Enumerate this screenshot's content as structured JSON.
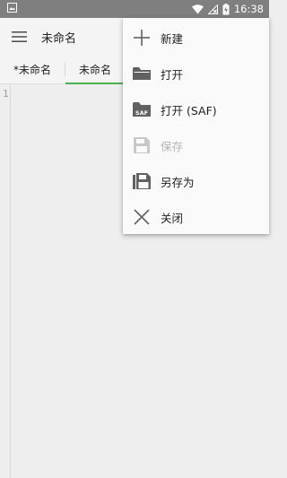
{
  "status_bar": {
    "time": "16:38",
    "icons": [
      "image-icon",
      "wifi-icon",
      "signal-off-icon",
      "battery-charging-icon"
    ]
  },
  "app_bar": {
    "title": "未命名",
    "menu_icon": "hamburger-menu-icon"
  },
  "tabs": [
    {
      "label": "*未命名",
      "active": false
    },
    {
      "label": "未命名",
      "active": true
    }
  ],
  "editor": {
    "line_numbers": [
      "1"
    ]
  },
  "menu": {
    "items": [
      {
        "label": "新建",
        "icon": "plus-icon",
        "enabled": true
      },
      {
        "label": "打开",
        "icon": "folder-icon",
        "enabled": true
      },
      {
        "label": "打开 (SAF)",
        "icon": "folder-saf-icon",
        "enabled": true
      },
      {
        "label": "保存",
        "icon": "save-icon",
        "enabled": false
      },
      {
        "label": "另存为",
        "icon": "save-as-icon",
        "enabled": true
      },
      {
        "label": "关闭",
        "icon": "close-icon",
        "enabled": true
      }
    ]
  },
  "colors": {
    "accent": "#4caf50",
    "status_bar": "#7f7f7f",
    "icon": "#616161",
    "icon_disabled": "#c2c2c2"
  }
}
